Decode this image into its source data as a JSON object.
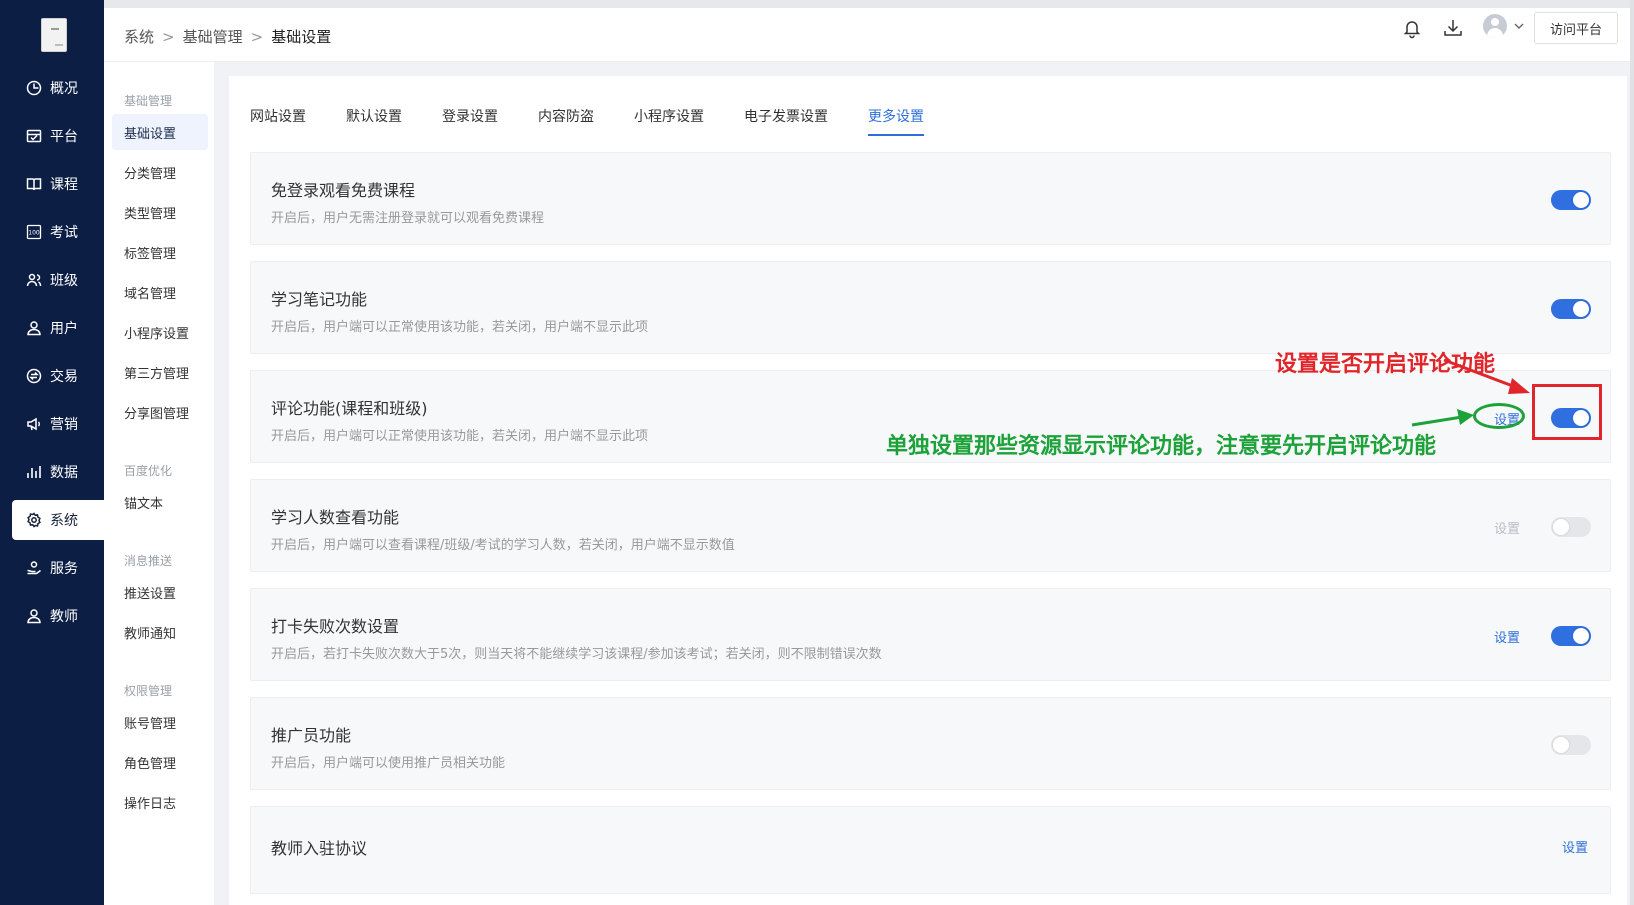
{
  "nav": {
    "items": [
      {
        "label": "概况",
        "icon": "pie-chart-icon"
      },
      {
        "label": "平台",
        "icon": "storefront-icon"
      },
      {
        "label": "课程",
        "icon": "book-icon"
      },
      {
        "label": "考试",
        "icon": "exam-100-icon"
      },
      {
        "label": "班级",
        "icon": "group-icon"
      },
      {
        "label": "用户",
        "icon": "user-icon"
      },
      {
        "label": "交易",
        "icon": "exchange-icon"
      },
      {
        "label": "营销",
        "icon": "megaphone-icon"
      },
      {
        "label": "数据",
        "icon": "bar-chart-icon"
      },
      {
        "label": "系统",
        "icon": "gear-icon",
        "active": true
      },
      {
        "label": "服务",
        "icon": "handshake-icon"
      },
      {
        "label": "教师",
        "icon": "teacher-icon"
      }
    ]
  },
  "header": {
    "breadcrumb": [
      "系统",
      "基础管理",
      "基础设置"
    ],
    "visit_button": "访问平台"
  },
  "submenu": {
    "groups": [
      {
        "title": "基础管理",
        "items": [
          "基础设置",
          "分类管理",
          "类型管理",
          "标签管理",
          "域名管理",
          "小程序设置",
          "第三方管理",
          "分享图管理"
        ]
      },
      {
        "title": "百度优化",
        "items": [
          "锚文本"
        ]
      },
      {
        "title": "消息推送",
        "items": [
          "推送设置",
          "教师通知"
        ]
      },
      {
        "title": "权限管理",
        "items": [
          "账号管理",
          "角色管理",
          "操作日志"
        ]
      }
    ],
    "active": "基础设置"
  },
  "tabs": [
    "网站设置",
    "默认设置",
    "登录设置",
    "内容防盗",
    "小程序设置",
    "电子发票设置",
    "更多设置"
  ],
  "active_tab": "更多设置",
  "settings": [
    {
      "title": "免登录观看免费课程",
      "desc": "开启后，用户无需注册登录就可以观看免费课程",
      "toggle": "on"
    },
    {
      "title": "学习笔记功能",
      "desc": "开启后，用户端可以正常使用该功能，若关闭，用户端不显示此项",
      "toggle": "on"
    },
    {
      "title": "评论功能(课程和班级)",
      "desc": "开启后，用户端可以正常使用该功能，若关闭，用户端不显示此项",
      "toggle": "on",
      "link": "设置"
    },
    {
      "title": "学习人数查看功能",
      "desc": "开启后，用户端可以查看课程/班级/考试的学习人数，若关闭，用户端不显示数值",
      "toggle": "off",
      "link": "设置"
    },
    {
      "title": "打卡失败次数设置",
      "desc": "开启后，若打卡失败次数大于5次，则当天将不能继续学习该课程/参加该考试；若关闭，则不限制错误次数",
      "toggle": "on",
      "link": "设置"
    },
    {
      "title": "推广员功能",
      "desc": "开启后，用户端可以使用推广员相关功能",
      "toggle": "off"
    },
    {
      "title": "教师入驻协议",
      "desc": "",
      "link": "设置"
    }
  ],
  "annotations": {
    "red_text": "设置是否开启评论功能",
    "green_text": "单独设置那些资源显示评论功能，注意要先开启评论功能"
  },
  "colors": {
    "nav_bg": "#0c1e44",
    "accent": "#2e6fd9",
    "toggle_on": "#2f6fe0",
    "annotation_red": "#e0262b",
    "annotation_green": "#1da23a"
  }
}
